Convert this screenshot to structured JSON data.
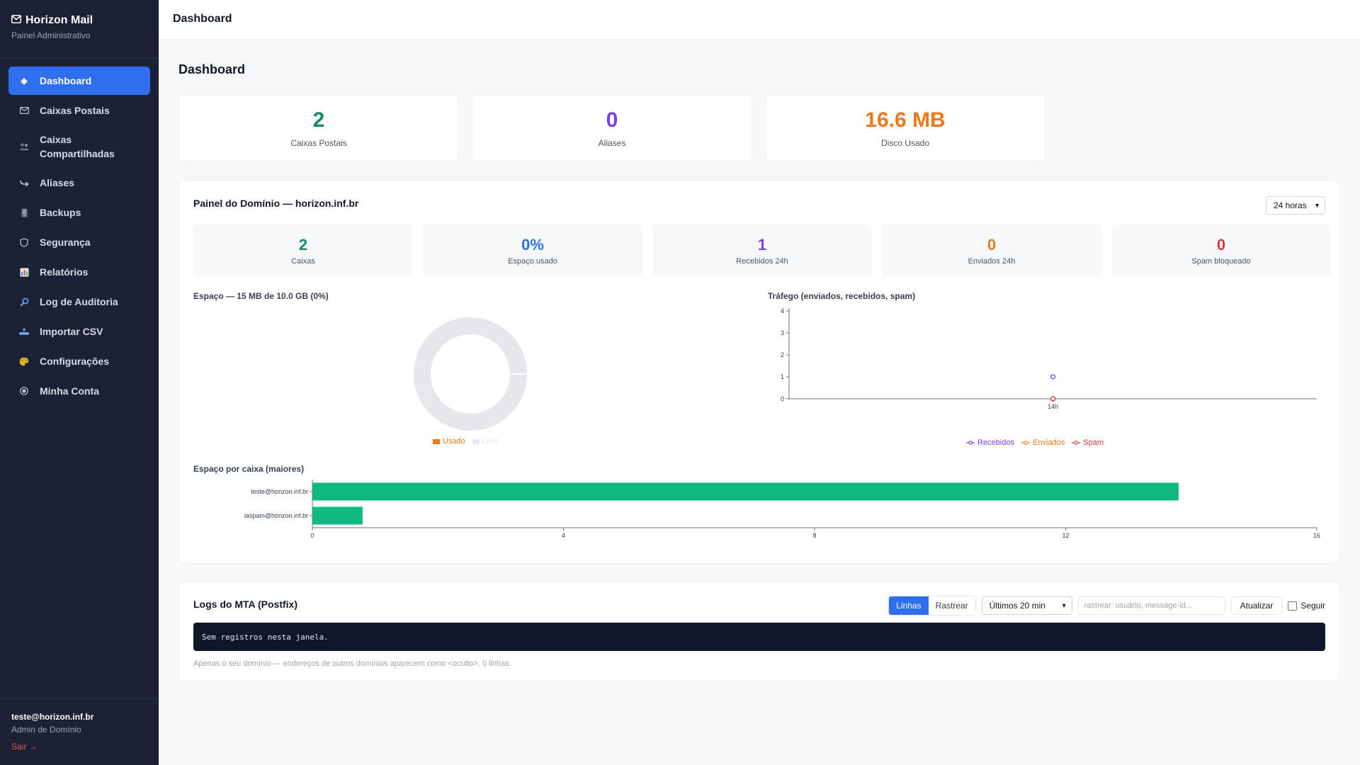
{
  "sidebar": {
    "brand_title": "Horizon Mail",
    "brand_subtitle": "Painel Administrativo",
    "items": [
      {
        "label": "Dashboard",
        "icon": "diamond-icon"
      },
      {
        "label": "Caixas Postais",
        "icon": "envelope-icon"
      },
      {
        "label": "Caixas Compartilhadas",
        "icon": "users-icon"
      },
      {
        "label": "Aliases",
        "icon": "forward-arrow-icon"
      },
      {
        "label": "Backups",
        "icon": "storage-icon"
      },
      {
        "label": "Segurança",
        "icon": "shield-icon"
      },
      {
        "label": "Relatórios",
        "icon": "bar-chart-icon"
      },
      {
        "label": "Log de Auditoria",
        "icon": "magnifier-icon"
      },
      {
        "label": "Importar CSV",
        "icon": "upload-tray-icon"
      },
      {
        "label": "Configurações",
        "icon": "palette-icon"
      },
      {
        "label": "Minha Conta",
        "icon": "user-circle-icon"
      }
    ],
    "footer": {
      "email": "teste@horizon.inf.br",
      "role": "Admin de Domínio",
      "logout": "Sair →"
    }
  },
  "topbar": {
    "title": "Dashboard"
  },
  "page": {
    "title": "Dashboard"
  },
  "stats": [
    {
      "value": "2",
      "label": "Caixas Postais",
      "color": "#16896b"
    },
    {
      "value": "0",
      "label": "Aliases",
      "color": "#7b3fe4"
    },
    {
      "value": "16.6 MB",
      "label": "Disco Usado",
      "color": "#ec7a1c"
    }
  ],
  "domain_panel": {
    "title": "Painel do Domínio — horizon.inf.br",
    "range_selected": "24 horas",
    "mini_stats": [
      {
        "value": "2",
        "label": "Caixas",
        "color": "#16896b"
      },
      {
        "value": "0%",
        "label": "Espaço usado",
        "color": "#2f6fed"
      },
      {
        "value": "1",
        "label": "Recebidos 24h",
        "color": "#7b3fe4"
      },
      {
        "value": "0",
        "label": "Enviados 24h",
        "color": "#ec7a1c"
      },
      {
        "value": "0",
        "label": "Spam bloqueado",
        "color": "#d63a3a"
      }
    ]
  },
  "chart_data": [
    {
      "type": "pie",
      "title": "Espaço — 15 MB de 10.0 GB (0%)",
      "categories": [
        "Usado",
        "Livre"
      ],
      "values": [
        15,
        10225
      ],
      "colors": [
        "#ec7a1c",
        "#e5e7eb"
      ],
      "legend": "bottom"
    },
    {
      "type": "line",
      "title": "Tráfego (enviados, recebidos, spam)",
      "x": [
        "14h"
      ],
      "series": [
        {
          "name": "Recebidos",
          "values": [
            1
          ],
          "color": "#7b3fe4"
        },
        {
          "name": "Enviados",
          "values": [
            0
          ],
          "color": "#ec7a1c"
        },
        {
          "name": "Spam",
          "values": [
            0
          ],
          "color": "#d63a3a"
        }
      ],
      "ylim": [
        0,
        4
      ],
      "yticks": [
        "0",
        "1",
        "2",
        "3",
        "4"
      ],
      "legend": "bottom"
    },
    {
      "type": "bar",
      "orientation": "horizontal",
      "title": "Espaço por caixa (maiores)",
      "categories": [
        "teste@horizon.inf.br",
        "iaspam@horizon.inf.br"
      ],
      "values": [
        13.8,
        0.8
      ],
      "color": "#10b981",
      "xlim": [
        0,
        16
      ],
      "xticks": [
        "0",
        "4",
        "8",
        "12",
        "16"
      ]
    }
  ],
  "logs_panel": {
    "title": "Logs do MTA (Postfix)",
    "mode_lines": "Linhas",
    "mode_trace": "Rastrear",
    "window_selected": "Últimos 20 min",
    "search_placeholder": "rastrear: usuário, message-id...",
    "refresh": "Atualizar",
    "follow": "Seguir",
    "console_text": "Sem registros nesta janela.",
    "note": "Apenas o seu domínio — endereços de outros domínios aparecem como <oculto>. 0 linhas."
  }
}
